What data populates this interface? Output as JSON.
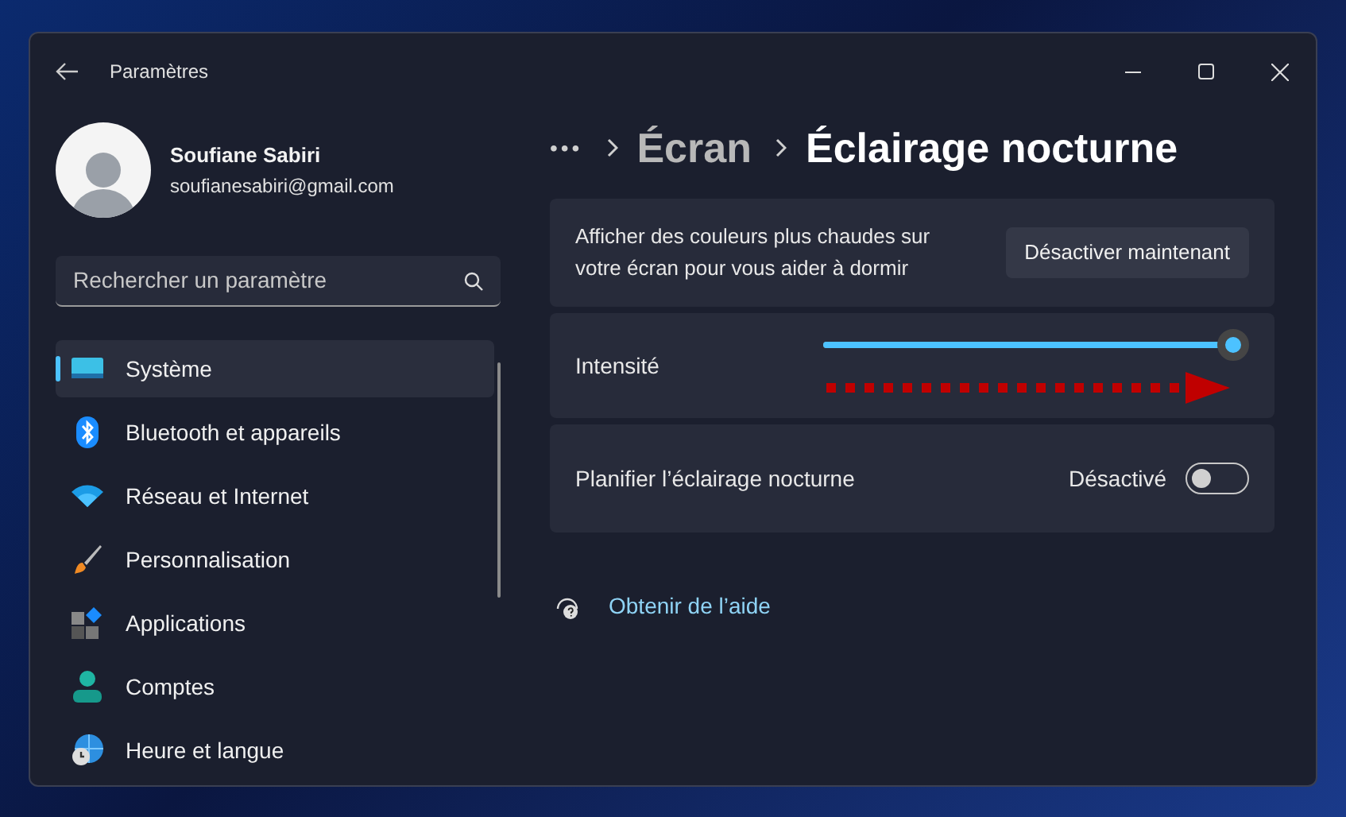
{
  "window": {
    "title": "Paramètres"
  },
  "account": {
    "name": "Soufiane Sabiri",
    "email": "soufianesabiri@gmail.com"
  },
  "search": {
    "placeholder": "Rechercher un paramètre"
  },
  "sidebar": {
    "items": [
      {
        "label": "Système",
        "kind": "display",
        "selected": true
      },
      {
        "label": "Bluetooth et appareils",
        "kind": "bluetooth",
        "selected": false
      },
      {
        "label": "Réseau et Internet",
        "kind": "wifi",
        "selected": false
      },
      {
        "label": "Personnalisation",
        "kind": "brush",
        "selected": false
      },
      {
        "label": "Applications",
        "kind": "apps",
        "selected": false
      },
      {
        "label": "Comptes",
        "kind": "person",
        "selected": false
      },
      {
        "label": "Heure et langue",
        "kind": "globe",
        "selected": false
      }
    ]
  },
  "breadcrumb": {
    "overflow": "•••",
    "items": [
      "Écran",
      "Éclairage nocturne"
    ]
  },
  "cards": [
    {
      "kind": "button",
      "text": "Afficher des couleurs plus chaudes sur votre écran pour vous aider à dormir",
      "button": "Désactiver maintenant"
    },
    {
      "kind": "slider",
      "text": "Intensité",
      "level": 1
    },
    {
      "kind": "toggle",
      "text": "Planifier l’éclairage nocturne",
      "state_label": "Désactivé",
      "on": false
    }
  ],
  "help_link": "Obtenir de l’aide"
}
